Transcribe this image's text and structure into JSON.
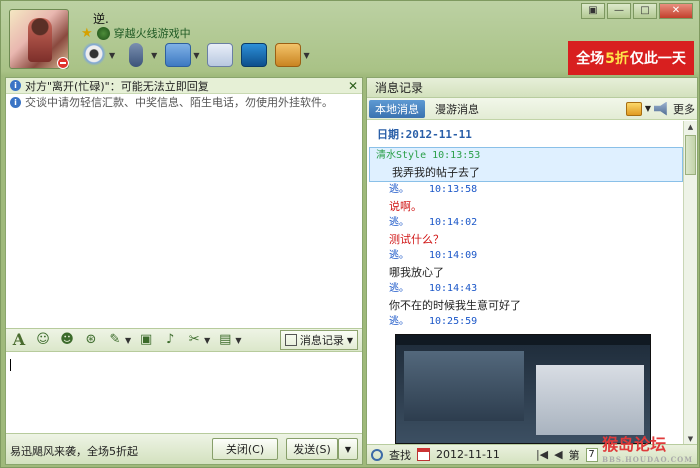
{
  "window": {
    "buttons": {
      "menu": "▣",
      "minimize": "—",
      "maximize": "□",
      "close": "✕"
    }
  },
  "contact": {
    "nickname": "逆.",
    "status_game": "穿越火线游戏中"
  },
  "ad": {
    "prefix": "全场",
    "highlight": "5折",
    "suffix": " 仅此一天"
  },
  "notices": [
    {
      "text": "对方\"离开(忙碌)\"：可能无法立即回复",
      "close": "✕"
    },
    {
      "text": "交谈中请勿轻信汇款、中奖信息、陌生电话，勿使用外挂软件。"
    }
  ],
  "chat_toolbar": {
    "font_glyph": "A",
    "history_label": "消息记录"
  },
  "bottom": {
    "promo": "易迅飓风来袭，全场5折起",
    "close_label": "关闭(C)",
    "send_label": "发送(S)"
  },
  "history": {
    "title": "消息记录",
    "tabs": [
      "本地消息",
      "漫游消息"
    ],
    "more": "更多",
    "date": "日期:2012-11-11",
    "messages": [
      {
        "sender": "清水Style",
        "time": "10:13:53",
        "text": "我弄我的帖子去了",
        "who": "peer",
        "selected": true
      },
      {
        "sender": "逃。",
        "time": "10:13:58",
        "text": "说啊。",
        "who": "me",
        "red": true
      },
      {
        "sender": "逃。",
        "time": "10:14:02",
        "text": "测试什么？",
        "who": "me",
        "red": true
      },
      {
        "sender": "逃。",
        "time": "10:14:09",
        "text": "哪我放心了",
        "who": "me"
      },
      {
        "sender": "逃。",
        "time": "10:14:43",
        "text": "你不在的时候我生意可好了",
        "who": "me"
      },
      {
        "sender": "逃。",
        "time": "10:25:59",
        "text": "",
        "who": "me"
      }
    ],
    "footer": {
      "search": "查找",
      "date": "2012-11-11",
      "page_prefix": "第",
      "page": "7"
    }
  },
  "watermark": {
    "main": "猴岛论坛",
    "sub": "BBS.HOUDAO.COM"
  },
  "colors": {
    "accent_red": "#d81f1f",
    "frame_green": "#a9c286",
    "link_blue": "#2a5fa8"
  }
}
